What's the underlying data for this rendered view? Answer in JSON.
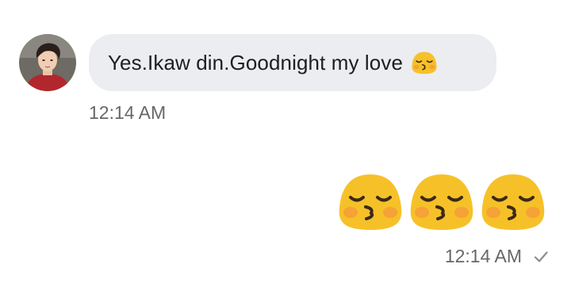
{
  "incoming": {
    "avatar_icon": "contact-avatar",
    "text": "Yes.Ikaw din.Goodnight my love",
    "inline_emoji_icon": "kissing-face-emoji",
    "time": "12:14 AM"
  },
  "outgoing": {
    "emojis": [
      "kissing-face-emoji",
      "kissing-face-emoji",
      "kissing-face-emoji"
    ],
    "time": "12:14 AM",
    "status_icon": "sent-check-icon"
  },
  "colors": {
    "bubble_bg": "#ebedf0",
    "text": "#1c1e21",
    "timestamp": "#65676b",
    "emoji_yellow": "#f6c128",
    "emoji_blush": "#f59a3a"
  }
}
